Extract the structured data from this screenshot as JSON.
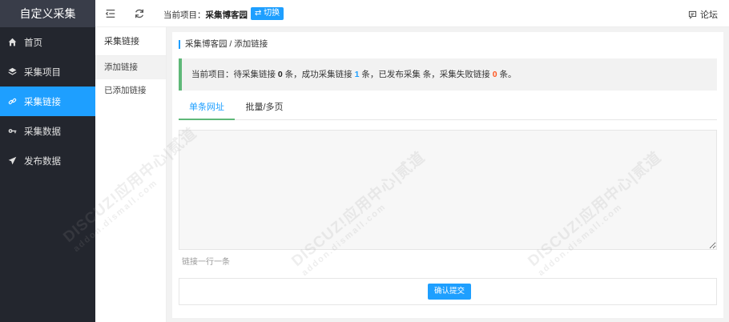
{
  "brand": {
    "title": "自定义采集"
  },
  "sidebar": {
    "items": [
      {
        "label": "首页",
        "icon": "home-icon"
      },
      {
        "label": "采集项目",
        "icon": "layers-icon"
      },
      {
        "label": "采集链接",
        "icon": "link-icon",
        "active": true
      },
      {
        "label": "采集数据",
        "icon": "key-icon"
      },
      {
        "label": "发布数据",
        "icon": "send-icon"
      }
    ]
  },
  "topbar": {
    "current_project_label": "当前项目：",
    "current_project_name": "采集博客园",
    "switch_label": "⇄ 切换",
    "forum_label": "论坛"
  },
  "subnav": {
    "title": "采集链接",
    "items": [
      {
        "label": "添加链接",
        "active": true
      },
      {
        "label": "已添加链接"
      }
    ]
  },
  "main": {
    "breadcrumb": "采集博客园 / 添加链接",
    "notice": {
      "p1": "当前项目：待采集链接 ",
      "pending": "0",
      "p2": " 条，成功采集链接 ",
      "success": "1",
      "p3": " 条，已发布采集 条，采集失败链接 ",
      "failed": "0",
      "p4": " 条。"
    },
    "tabs": [
      {
        "label": "单条网址",
        "active": true
      },
      {
        "label": "批量/多页"
      }
    ],
    "textarea_value": "",
    "hint": "链接一行一条",
    "submit_label": "确认提交"
  },
  "watermark": {
    "text": "DISCUZ!应用中心|贰道",
    "sub": "addon.dismall.com"
  },
  "colors": {
    "accent": "#1e9fff",
    "sidebar_bg": "#23262e",
    "notice_border": "#5fb878",
    "danger": "#ff5722"
  }
}
